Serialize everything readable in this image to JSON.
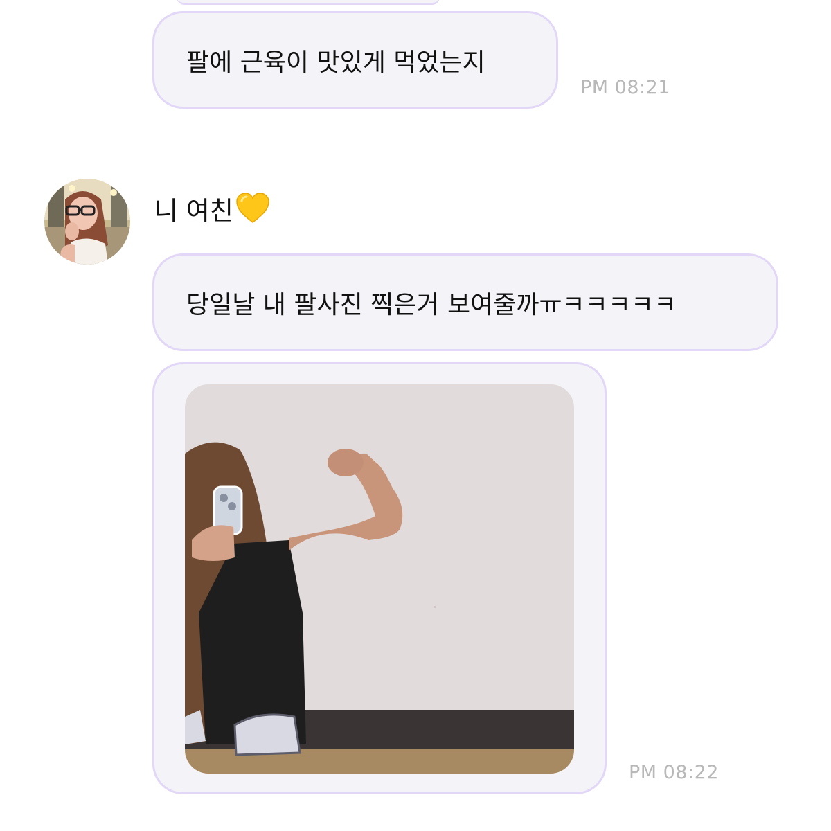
{
  "messages": [
    {
      "text": "팔에 근육이 맛있게 먹었는지",
      "time": "PM 08:21"
    },
    {
      "text": "당일날 내 팔사진 찍은거 보여줄까ㅠㅋㅋㅋㅋㅋ"
    },
    {
      "type": "photo",
      "time": "PM 08:22"
    }
  ],
  "sender": {
    "name": "니 여친",
    "badge_icon": "yellow-heart-icon"
  },
  "colors": {
    "bubble_bg": "#f3f3f8",
    "bubble_border": "#e2d7f7",
    "timestamp": "#b8b8b8",
    "heart": "#ffc61a"
  }
}
